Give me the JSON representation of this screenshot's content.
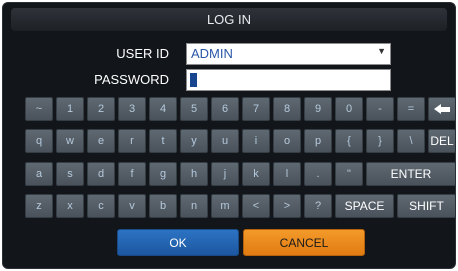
{
  "title": "LOG IN",
  "labels": {
    "user_id": "USER ID",
    "password": "PASSWORD"
  },
  "fields": {
    "user_id_value": "ADMIN",
    "password_value": ""
  },
  "keyboard": {
    "rows": [
      [
        "~",
        "1",
        "2",
        "3",
        "4",
        "5",
        "6",
        "7",
        "8",
        "9",
        "0",
        "-",
        "=",
        "backspace-icon"
      ],
      [
        "q",
        "w",
        "e",
        "r",
        "t",
        "y",
        "u",
        "i",
        "o",
        "p",
        "{",
        "}",
        "\\",
        "DEL"
      ],
      [
        "a",
        "s",
        "d",
        "f",
        "g",
        "h",
        "j",
        "k",
        "l",
        ".",
        "\"",
        "ENTER"
      ],
      [
        "z",
        "x",
        "c",
        "v",
        "b",
        "n",
        "m",
        "<",
        ">",
        "?",
        "SPACE",
        "SHIFT"
      ]
    ]
  },
  "buttons": {
    "ok": "OK",
    "cancel": "CANCEL"
  },
  "colors": {
    "ok": "#2368b8",
    "cancel": "#f08a1e",
    "key": "#555f68",
    "key_text": "#b5c9dc",
    "dialog_bg": "#121519"
  }
}
